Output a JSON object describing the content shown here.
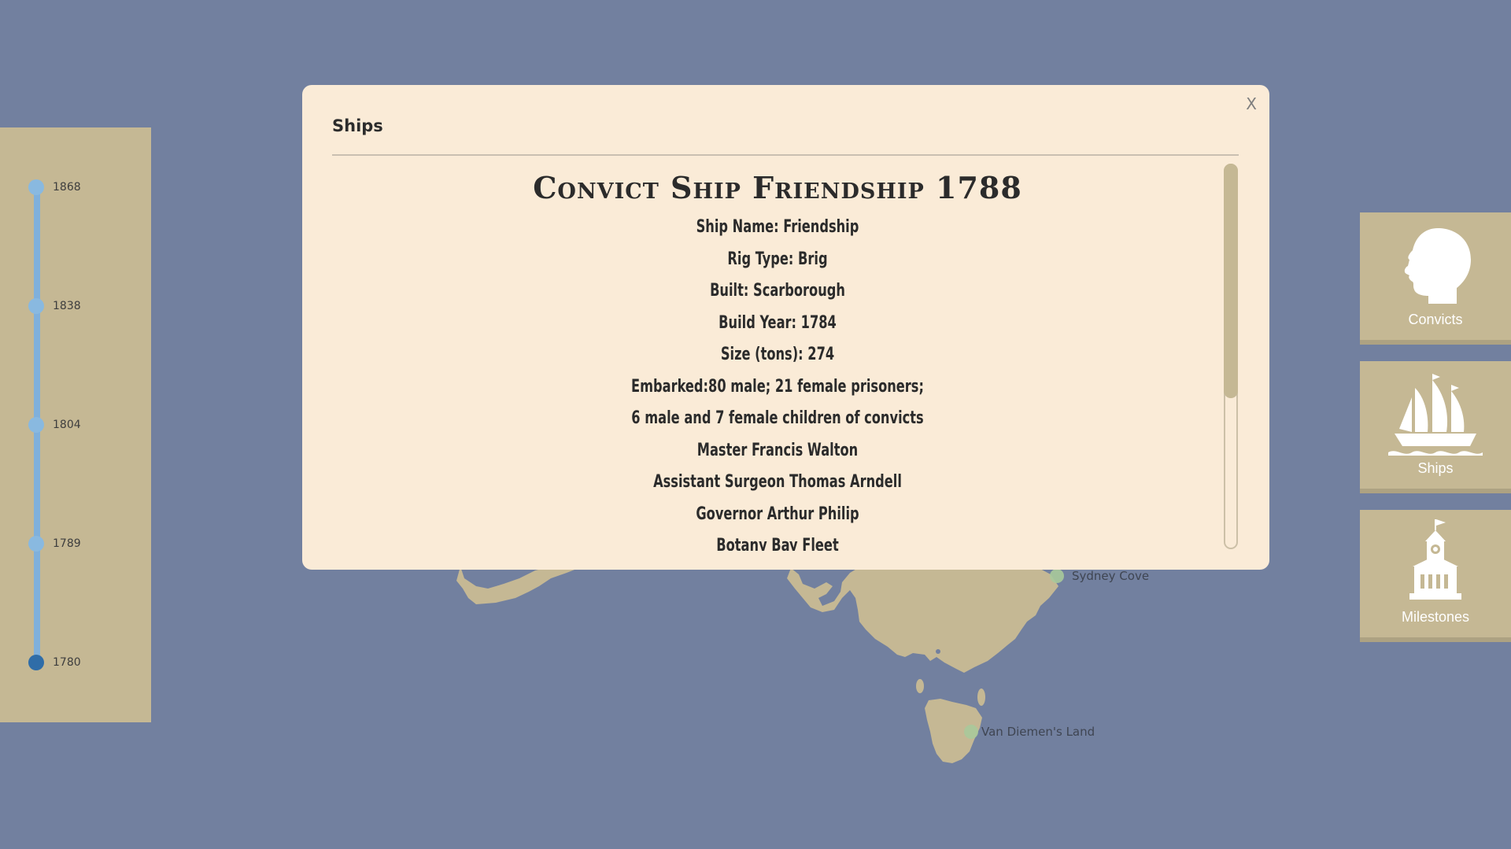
{
  "map": {
    "labels": [
      "Sydney Cove",
      "Van Diemen's Land"
    ]
  },
  "timeline": {
    "years": [
      "1868",
      "1838",
      "1804",
      "1789",
      "1780"
    ],
    "selected": "1780"
  },
  "side_buttons": [
    {
      "label": "Convicts",
      "icon": "head-silhouette-icon"
    },
    {
      "label": "Ships",
      "icon": "sailing-ship-icon"
    },
    {
      "label": "Milestones",
      "icon": "clocktower-building-icon"
    }
  ],
  "modal": {
    "title": "Ships",
    "close_label": "X",
    "heading": "Convict Ship Friendship 1788",
    "lines": [
      "Ship Name: Friendship",
      "Rig Type: Brig",
      "Built: Scarborough",
      "Build Year: 1784",
      "Size (tons): 274",
      "Embarked:80 male; 21 female prisoners;",
      "6 male and 7 female children of convicts",
      "Master Francis Walton",
      "Assistant Surgeon Thomas Arndell",
      "Governor Arthur Philip",
      "Botany Bay Fleet"
    ]
  },
  "colors": {
    "ocean": "#72809f",
    "land": "#c5b894",
    "panel": "#faebd7",
    "timeline_active": "#2f6da8",
    "timeline_track": "#7fb0dc"
  }
}
